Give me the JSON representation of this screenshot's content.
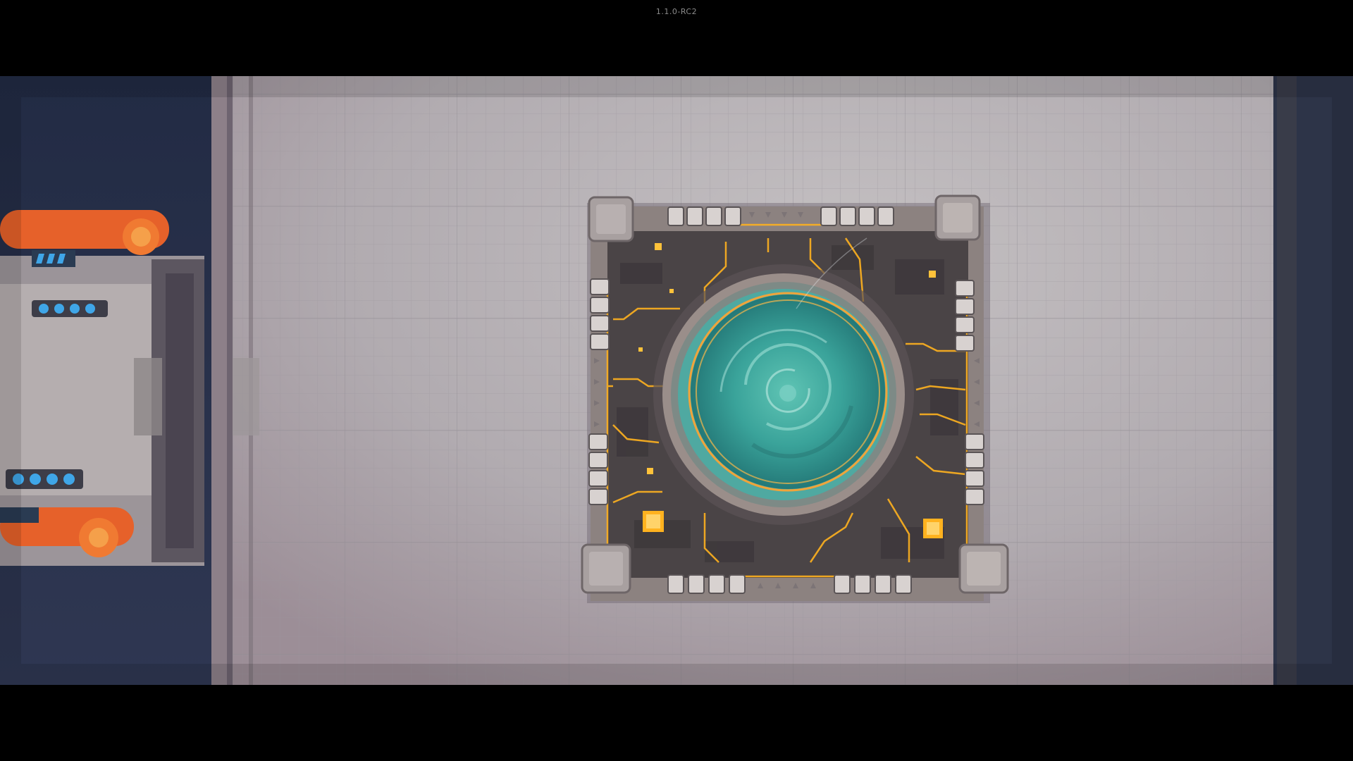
{
  "hud": {
    "version_label": "1.1.0-RC2"
  },
  "scene": {
    "description_icons": [
      "vortex-portal-icon",
      "factory-building-icon"
    ],
    "colors": {
      "letterbox": "#000000",
      "void_background": "#2a3450",
      "floor": "#b3aeb3",
      "floor_grid": "#9c979e",
      "platform_frame": "#8c8280",
      "platform_circuit": "#4a4446",
      "energy_trace": "#ffb21f",
      "portal_water": "#3aa39a",
      "portal_ring": "#f0a43a",
      "building_accent": "#f06b22",
      "building_blue": "#3fa6e8"
    }
  }
}
